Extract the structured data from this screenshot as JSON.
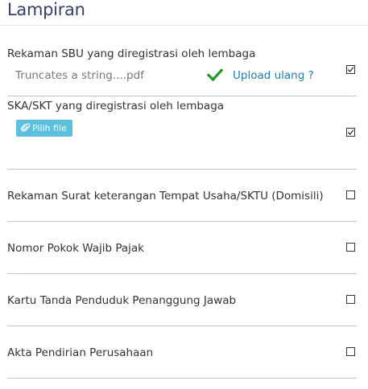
{
  "section": {
    "title": "Lampiran"
  },
  "attachments": [
    {
      "label": "Rekaman SBU yang diregistrasi oleh lembaga",
      "file_name": "Truncates a string....pdf",
      "upload_again_label": "Upload ulang ?",
      "checked": true
    },
    {
      "label": "SKA/SKT yang diregistrasi oleh lembaga",
      "pick_file_label": "Pilih file",
      "checked": true
    },
    {
      "label": "Rekaman Surat keterangan Tempat Usaha/SKTU (Domisili)",
      "checked": false
    },
    {
      "label": "Nomor Pokok Wajib Pajak",
      "checked": false
    },
    {
      "label": "Kartu Tanda Penduduk Penanggung Jawab",
      "checked": false
    },
    {
      "label": "Akta Pendirian Perusahaan",
      "checked": false
    }
  ],
  "colors": {
    "title": "#34406b",
    "link": "#1a7fb3",
    "button": "#5bc0de",
    "success": "#1e9b1e",
    "divider": "#b8c4e8"
  },
  "icons": {
    "success": "check-icon",
    "button": "paperclip-icon",
    "checkbox_checked": "checkbox-checked-icon"
  }
}
